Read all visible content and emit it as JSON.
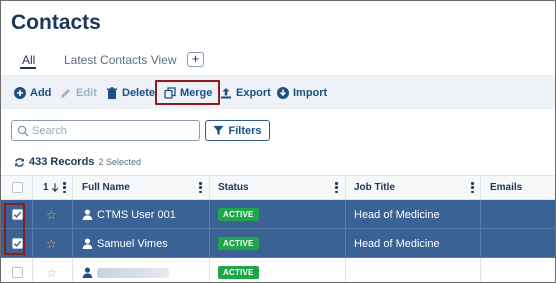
{
  "page": {
    "title": "Contacts"
  },
  "tabs": [
    {
      "label": "All",
      "active": true
    },
    {
      "label": "Latest Contacts View",
      "active": false
    }
  ],
  "tab_add_label": "+",
  "toolbar": {
    "add": "Add",
    "edit": "Edit",
    "delete": "Delete",
    "merge": "Merge",
    "export": "Export",
    "import": "Import"
  },
  "search": {
    "placeholder": "Search",
    "value": ""
  },
  "filters_label": "Filters",
  "records": {
    "count": "433 Records",
    "selected": "2 Selected"
  },
  "table": {
    "sort_column": "1",
    "columns": [
      "Full Name",
      "Status",
      "Job Title",
      "Emails"
    ],
    "rows": [
      {
        "selected": true,
        "name": "CTMS User 001",
        "status": "ACTIVE",
        "job_title": "Head of Medicine",
        "emails": ""
      },
      {
        "selected": true,
        "name": "Samuel Vimes",
        "status": "ACTIVE",
        "job_title": "Head of Medicine",
        "emails": ""
      },
      {
        "selected": false,
        "name": "",
        "status": "ACTIVE",
        "job_title": "",
        "emails": ""
      }
    ]
  },
  "colors": {
    "accent": "#1d4f86",
    "selected_row": "#3a6294",
    "active_badge": "#1fa64a",
    "highlight_border": "#8b1d1d",
    "star": "#e8b84a"
  },
  "icons": [
    "plus-circle-icon",
    "pencil-icon",
    "trash-icon",
    "merge-icon",
    "export-icon",
    "import-icon",
    "search-icon",
    "filter-icon",
    "refresh-icon",
    "sort-down-icon",
    "star-icon",
    "person-icon",
    "checkmark-icon"
  ]
}
